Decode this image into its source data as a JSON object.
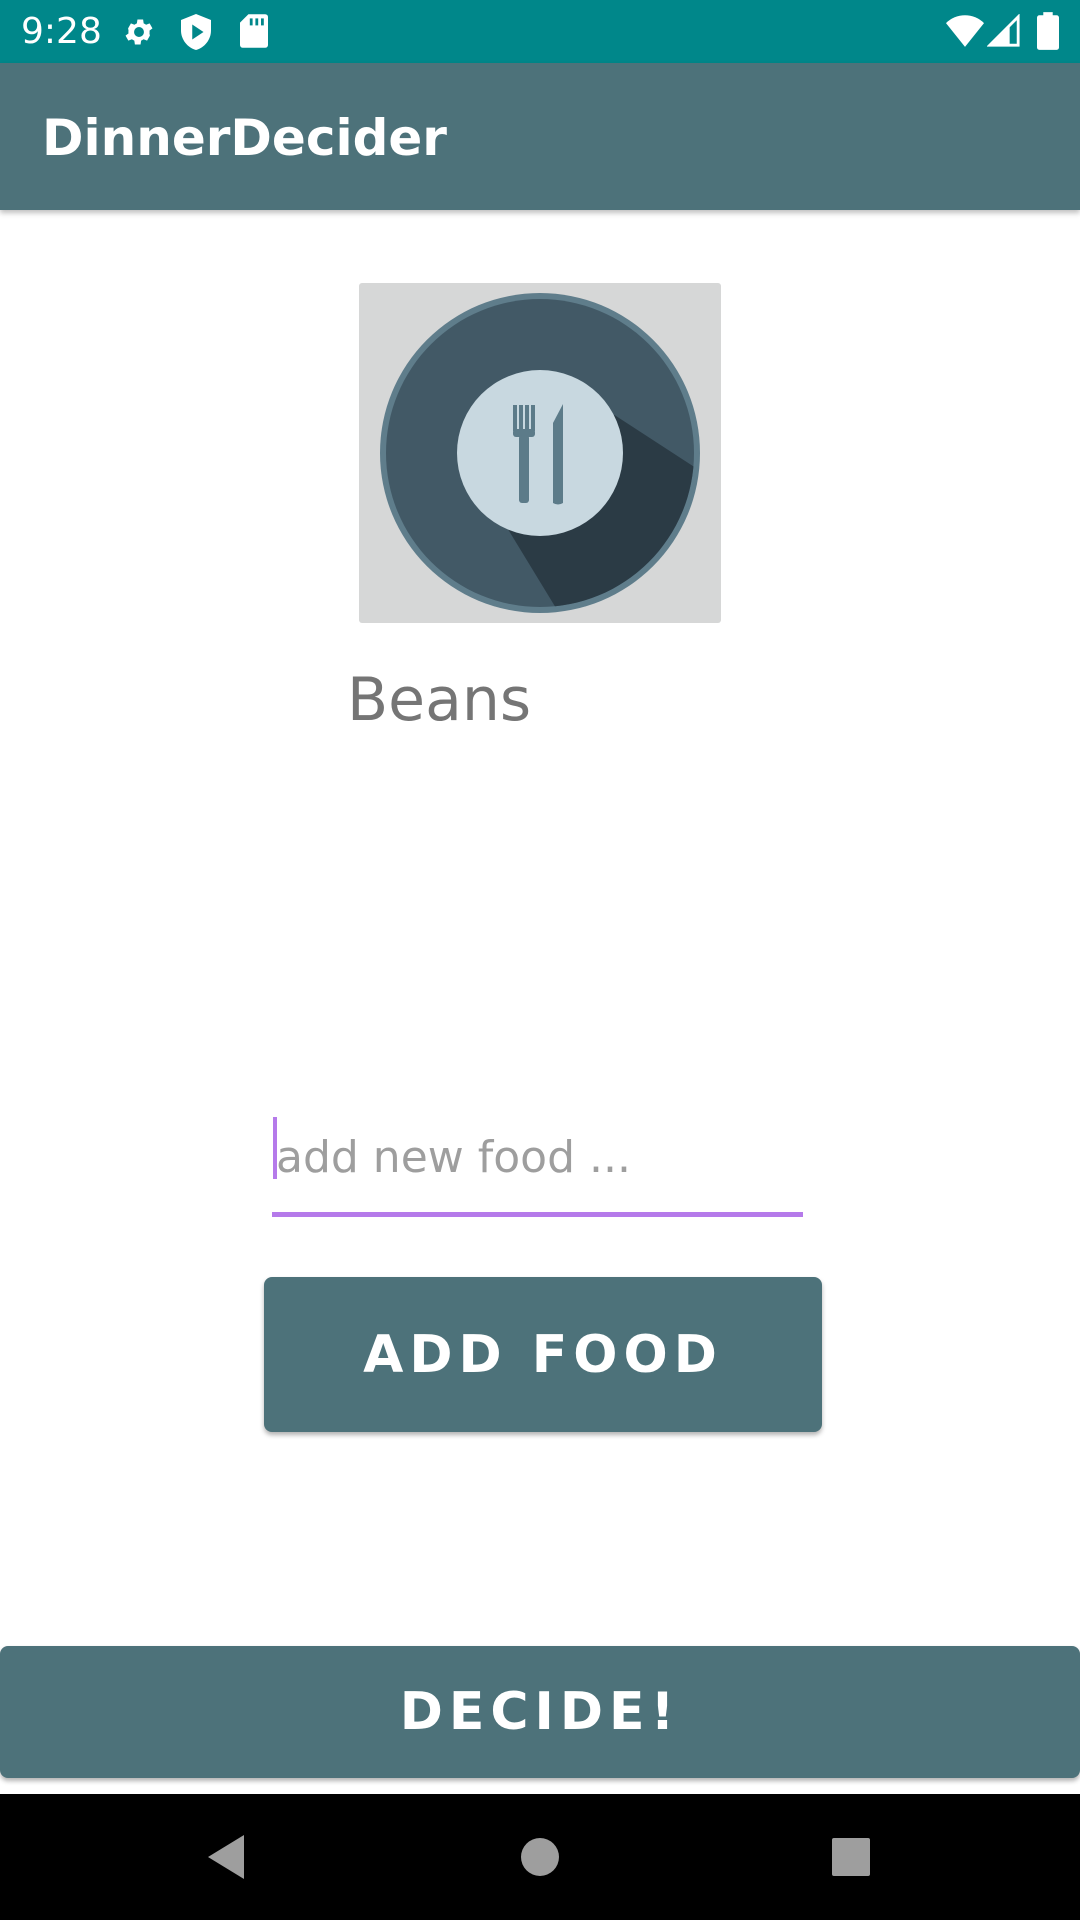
{
  "status_bar": {
    "time": "9:28",
    "icons_left": [
      "settings-icon",
      "shield-play-icon",
      "sd-card-icon"
    ],
    "icons_right": [
      "wifi-icon",
      "cell-signal-icon",
      "battery-icon"
    ]
  },
  "app_bar": {
    "title": "DinnerDecider"
  },
  "main": {
    "food_image_icon": "plate-fork-knife-icon",
    "food_name": "Beans",
    "input": {
      "value": "",
      "placeholder": "add new food ..."
    },
    "add_button_label": "ADD FOOD"
  },
  "footer": {
    "decide_button_label": "DECIDE!"
  },
  "nav_bar": {
    "icons": [
      "back-icon",
      "home-icon",
      "recents-icon"
    ]
  },
  "colors": {
    "status_bar": "#00878a",
    "primary": "#4d727a",
    "accent": "#b57aea",
    "text_secondary": "#757575"
  }
}
